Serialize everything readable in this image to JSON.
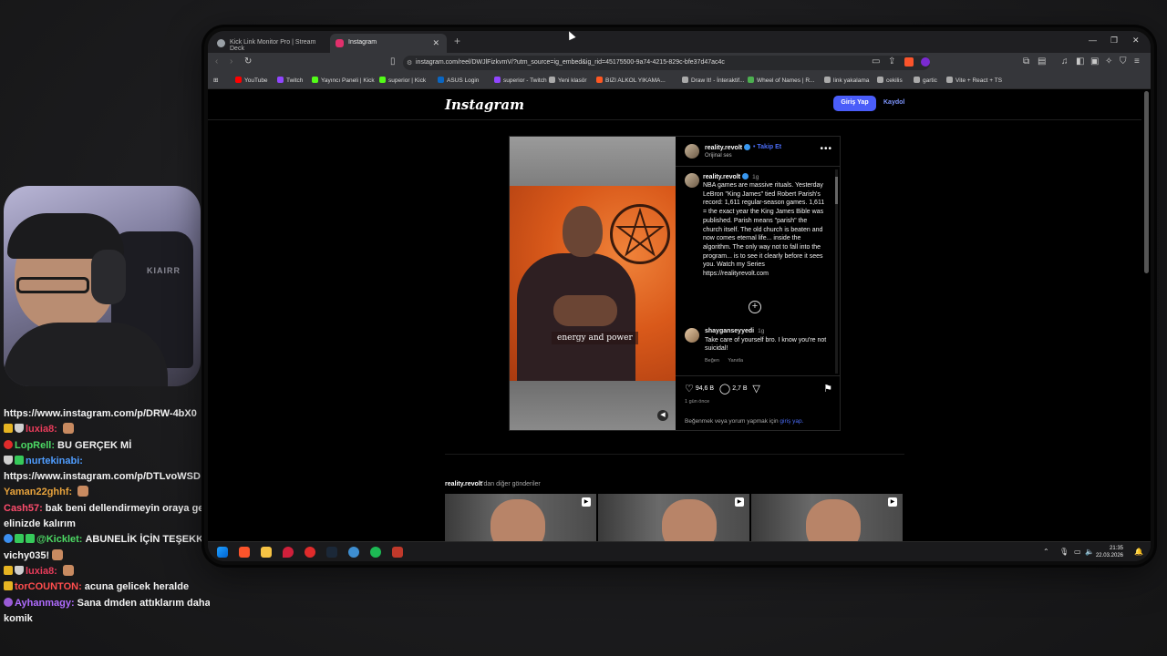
{
  "chat": [
    {
      "user": "",
      "message": "https://www.instagram.com/p/DRW-4bX0",
      "user_color": "#ffffff",
      "badges": []
    },
    {
      "user": "luxia8:",
      "message": "",
      "user_color": "#e83c5a",
      "badges": [
        "gold",
        "shield"
      ],
      "emote": true
    },
    {
      "user": "LopRell:",
      "message": "BU GERÇEK Mİ",
      "user_color": "#4cd964",
      "badges": [
        "red"
      ]
    },
    {
      "user": "nurtekinabi:",
      "message": "",
      "user_color": "#4f9dff",
      "badges": [
        "shield",
        "green"
      ]
    },
    {
      "user": "",
      "message": "https://www.instagram.com/p/DTLvoWSD",
      "user_color": "#ffffff",
      "badges": []
    },
    {
      "user": "Yaman22ghhf:",
      "message": "",
      "user_color": "#e8a33c",
      "badges": [],
      "emote": true
    },
    {
      "user": "Cash57:",
      "message": "bak beni dellendirmeyin oraya ge",
      "user_color": "#ff4d6d",
      "badges": []
    },
    {
      "user": "",
      "message": "elinizde kalırım",
      "user_color": "#ffffff",
      "badges": []
    },
    {
      "user": "@Kicklet:",
      "message": "ABUNELİK İÇİN TEŞEKKÜRLE",
      "user_color": "#4cd964",
      "badges": [
        "blue",
        "green",
        "green"
      ]
    },
    {
      "user": "",
      "message": "vichy035!",
      "user_color": "#ffffff",
      "badges": [],
      "emote": true
    },
    {
      "user": "luxia8:",
      "message": "",
      "user_color": "#e83c5a",
      "badges": [
        "gold",
        "shield"
      ],
      "emote": true
    },
    {
      "user": "torCOUNTON:",
      "message": "acuna gelicek heralde",
      "user_color": "#ff4d4d",
      "badges": [
        "gold"
      ]
    },
    {
      "user": "Ayhanmagy:",
      "message": "Sana dmden attıklarım daha",
      "user_color": "#b06cff",
      "badges": [
        "purple"
      ]
    },
    {
      "user": "",
      "message": "komik",
      "user_color": "#ffffff",
      "badges": []
    }
  ],
  "webcam": {
    "chair_brand": "KIAIRR"
  },
  "browser": {
    "tabs": [
      {
        "label": "Kick Link Monitor Pro | Stream Deck",
        "active": false,
        "icon_color": "#9aa0a6"
      },
      {
        "label": "Instagram",
        "active": true,
        "icon_color": "#e1306c"
      }
    ],
    "new_tab": "+",
    "url": "instagram.com/reel/DWJlFizkvmV/?utm_source=ig_embed&ig_rid=45175500-9a74-4215-829c-bfe37d47ac4c",
    "bookmarks": [
      {
        "label": "YouTube",
        "color": "#ff0000"
      },
      {
        "label": "Twitch",
        "color": "#9146ff"
      },
      {
        "label": "Yayıncı Paneli | Kick",
        "color": "#53fc18"
      },
      {
        "label": "superior | Kick",
        "color": "#53fc18"
      },
      {
        "label": "ASUS Login",
        "color": "#0a66c2"
      },
      {
        "label": "superior - Twitch",
        "color": "#9146ff"
      },
      {
        "label": "Yeni klasör",
        "color": "#aaaaaa"
      },
      {
        "label": "BIZI ALKOL YIKAMA...",
        "color": "#ff5722"
      },
      {
        "label": "Draw It! - İnteraktif...",
        "color": "#aaaaaa"
      },
      {
        "label": "Wheel of Names | R...",
        "color": "#4caf50"
      },
      {
        "label": "link yakalama",
        "color": "#aaaaaa"
      },
      {
        "label": "cekilis",
        "color": "#aaaaaa"
      },
      {
        "label": "gartic",
        "color": "#aaaaaa"
      },
      {
        "label": "Vite + React + TS",
        "color": "#aaaaaa"
      }
    ]
  },
  "instagram": {
    "logo": "Instagram",
    "login_button": "Giriş Yap",
    "signup_link": "Kaydol",
    "post": {
      "username": "reality.revolt",
      "follow": "• Takip Et",
      "audio": "Orijinal ses",
      "video_caption": "energy and power",
      "caption_time": "1g",
      "caption": "NBA games are massive rituals. Yesterday LeBron \"King James\" tied Robert Parish's record: 1,611 regular-season games. 1,611 = the exact year the King James Bible was published. Parish means \"parish\" the church itself. The old church is beaten and now comes eternal life... inside the algorithm. The only way not to fall into the program... is to see it clearly before it sees you. Watch my Series https://realityrevolt.com",
      "comment": {
        "username": "shayganseyyedi",
        "time": "1g",
        "text": "Take care of yourself bro. I know you're not suicidal!",
        "like": "Beğen",
        "reply": "Yanıtla"
      },
      "likes": "94,6 B",
      "comments": "2,7 B",
      "ago": "1 gün önce",
      "login_prompt": "Beğenmek veya yorum yapmak için",
      "login_link": "giriş yap."
    },
    "more_posts_user": "reality.revolt",
    "more_posts_suffix": "'dan diğer gönderiler"
  },
  "taskbar": {
    "time": "21:35",
    "date": "22.03.2026"
  }
}
